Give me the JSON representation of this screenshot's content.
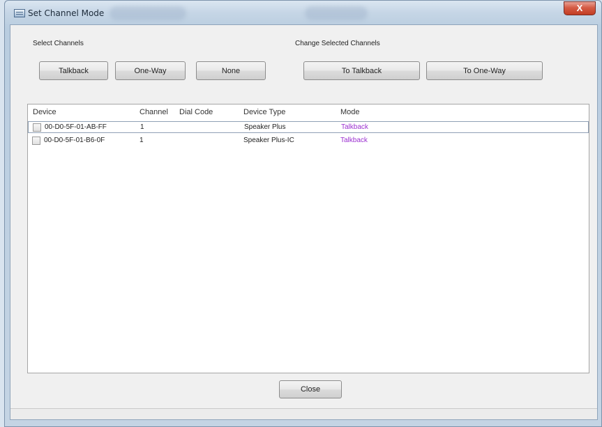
{
  "window": {
    "title": "Set Channel Mode",
    "close_glyph": "X"
  },
  "select_channels": {
    "label": "Select Channels",
    "buttons": [
      "Talkback",
      "One-Way",
      "None"
    ]
  },
  "change_selected": {
    "label": "Change Selected Channels",
    "buttons": [
      "To Talkback",
      "To One-Way"
    ]
  },
  "table": {
    "columns": [
      "Device",
      "Channel",
      "Dial Code",
      "Device Type",
      "Mode"
    ],
    "rows": [
      {
        "device": "00-D0-5F-01-AB-FF",
        "channel": "1",
        "dial_code": "",
        "device_type": "Speaker Plus",
        "mode": "Talkback"
      },
      {
        "device": "00-D0-5F-01-B6-0F",
        "channel": "1",
        "dial_code": "",
        "device_type": "Speaker Plus-IC",
        "mode": "Talkback"
      }
    ]
  },
  "footer": {
    "close_label": "Close"
  },
  "colors": {
    "mode_text": "#9b30d0",
    "close_button": "#c23c22"
  },
  "icons": {
    "app": "window-app-icon",
    "close": "close-x-icon"
  }
}
